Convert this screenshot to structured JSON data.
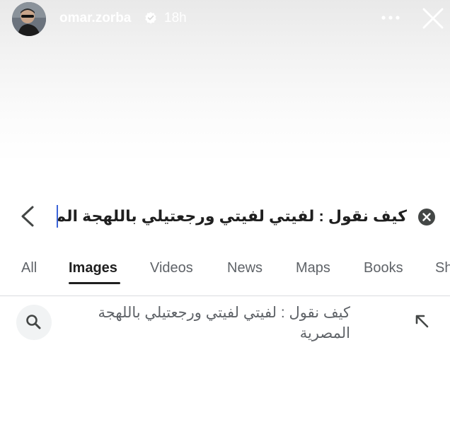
{
  "story": {
    "username": "omar.zorba",
    "time_ago": "18h",
    "verified_icon": "verified-badge-icon",
    "more_icon": "more-horizontal-icon",
    "close_icon": "close-icon"
  },
  "search": {
    "query": "كيف نقول : لفيتي لفيتي ورجعتيلي باللهجة المصرية",
    "back_icon": "back-chevron-icon",
    "clear_icon": "clear-circle-icon"
  },
  "tabs": [
    {
      "label": "All",
      "active": false
    },
    {
      "label": "Images",
      "active": true
    },
    {
      "label": "Videos",
      "active": false
    },
    {
      "label": "News",
      "active": false
    },
    {
      "label": "Maps",
      "active": false
    },
    {
      "label": "Books",
      "active": false
    },
    {
      "label": "Sh",
      "active": false
    }
  ],
  "suggestion": {
    "text": "كيف نقول : لفيتي لفيتي ورجعتيلي باللهجة المصرية",
    "search_icon": "search-icon",
    "fill_icon": "arrow-up-left-icon"
  },
  "colors": {
    "accent_caret": "#3b63d8",
    "text_primary": "#1f1f1f",
    "text_secondary": "#5f6368"
  }
}
